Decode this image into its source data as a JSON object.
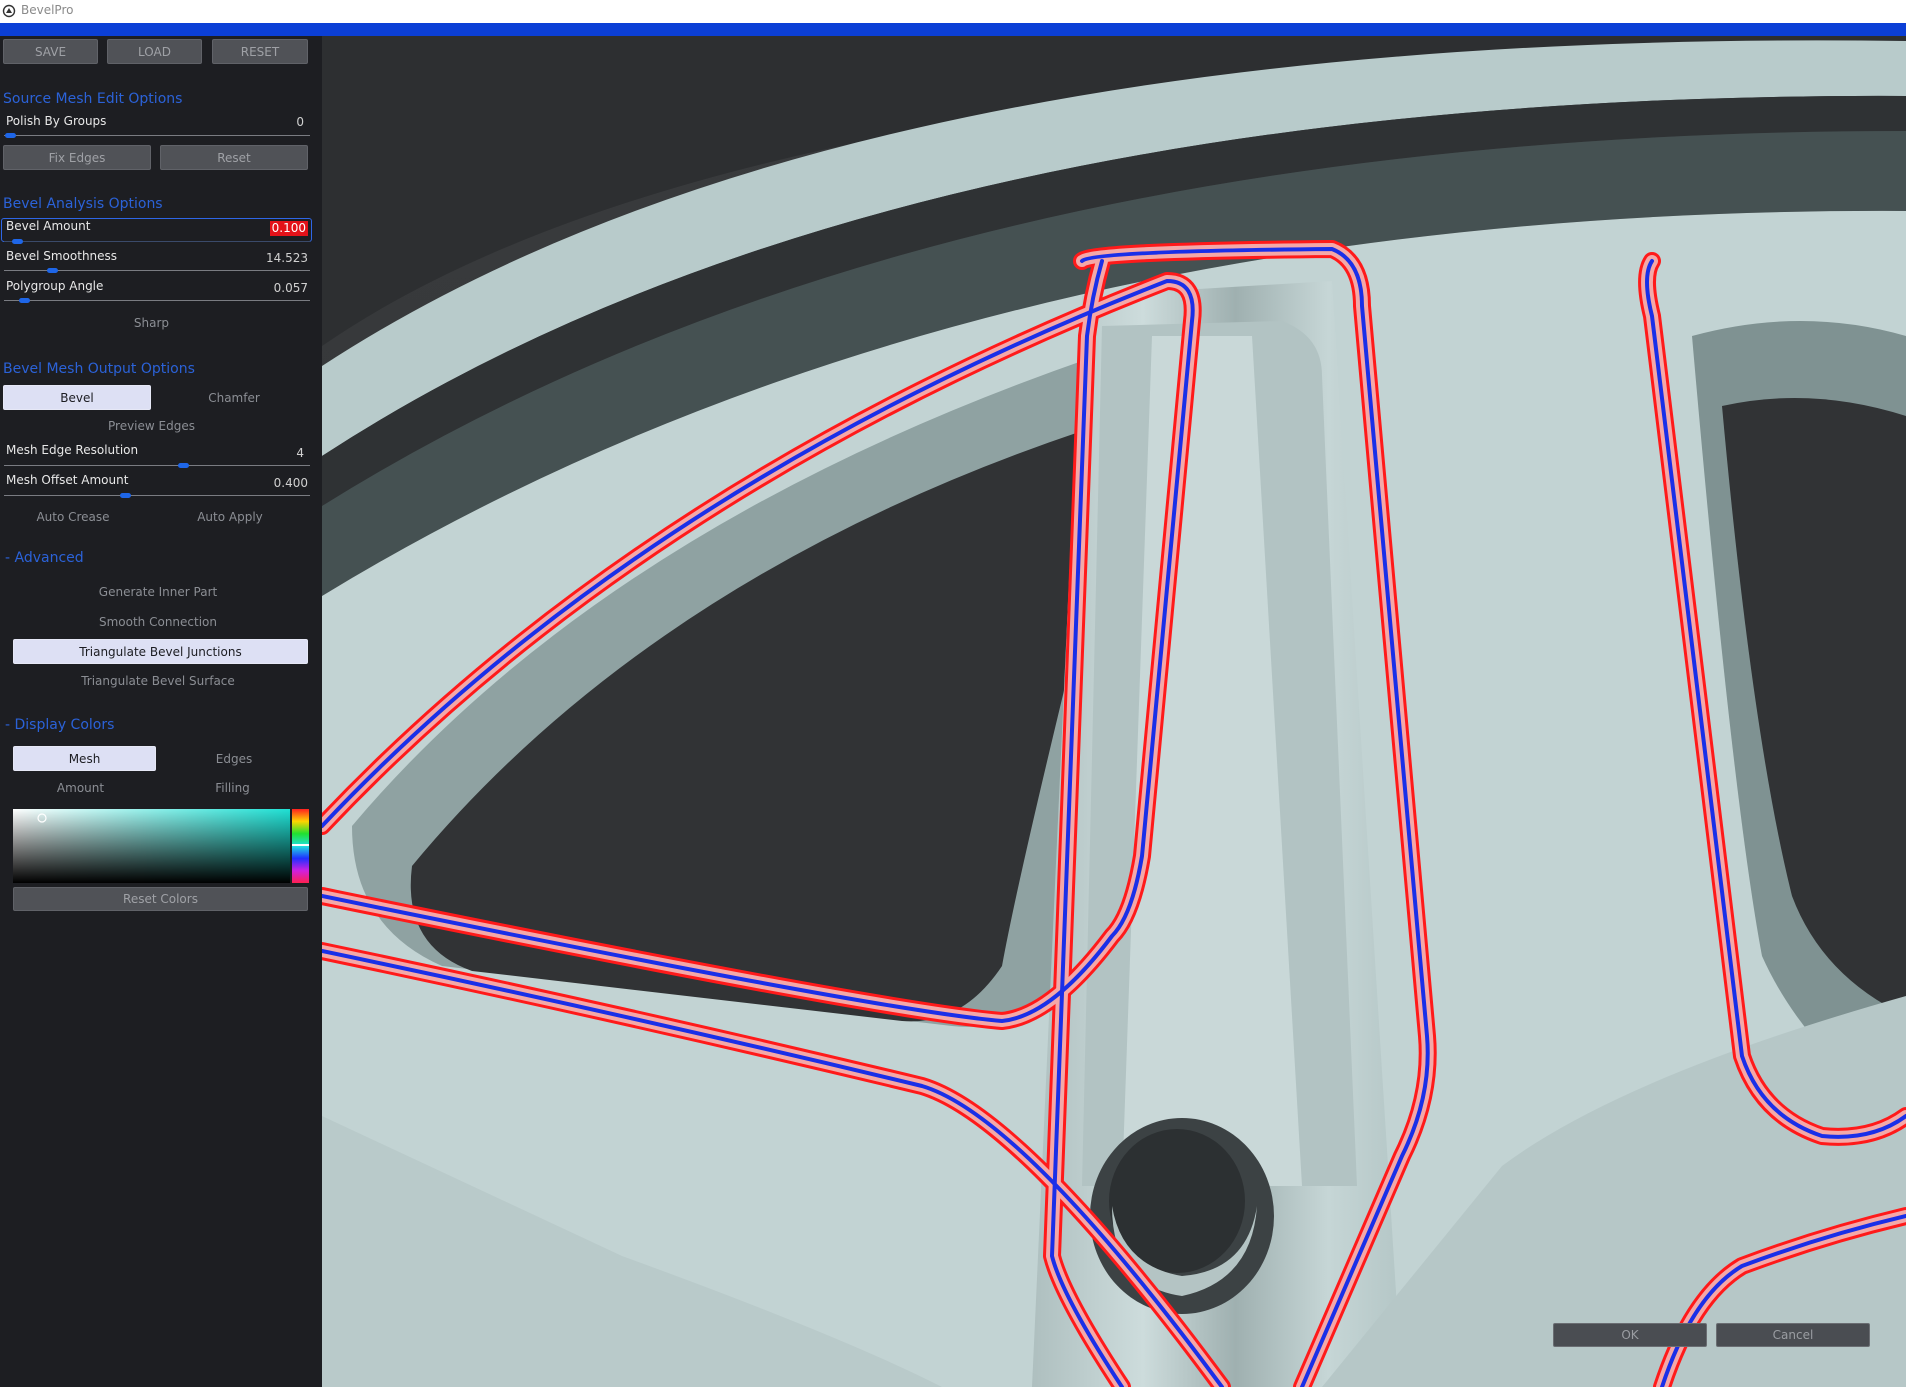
{
  "window": {
    "title": "BevelPro"
  },
  "toolbar": {
    "save": "SAVE",
    "load": "LOAD",
    "reset": "RESET"
  },
  "source_mesh": {
    "heading": "Source Mesh Edit Options",
    "polish_label": "Polish By Groups",
    "polish_value": "0",
    "fix_edges": "Fix Edges",
    "reset": "Reset"
  },
  "bevel_analysis": {
    "heading": "Bevel Analysis Options",
    "amount_label": "Bevel Amount",
    "amount_value": "0.100",
    "smoothness_label": "Bevel Smoothness",
    "smoothness_value": "14.523",
    "angle_label": "Polygroup Angle",
    "angle_value": "0.057",
    "sharp": "Sharp"
  },
  "bevel_output": {
    "heading": "Bevel Mesh Output Options",
    "bevel": "Bevel",
    "chamfer": "Chamfer",
    "preview_edges": "Preview Edges",
    "resolution_label": "Mesh Edge Resolution",
    "resolution_value": "4",
    "offset_label": "Mesh Offset Amount",
    "offset_value": "0.400",
    "auto_crease": "Auto Crease",
    "auto_apply": "Auto Apply"
  },
  "advanced": {
    "heading": "- Advanced",
    "generate_inner": "Generate Inner Part",
    "smooth_connection": "Smooth Connection",
    "triangulate_junctions": "Triangulate Bevel Junctions",
    "triangulate_surface": "Triangulate Bevel Surface"
  },
  "display_colors": {
    "heading": "- Display Colors",
    "mesh": "Mesh",
    "edges": "Edges",
    "amount": "Amount",
    "filling": "Filling",
    "reset_colors": "Reset Colors"
  },
  "dialog": {
    "ok": "OK",
    "cancel": "Cancel"
  },
  "colors": {
    "accent": "#0b3fd6",
    "heading": "#2b62d8",
    "edge_outer": "#ff1a1a",
    "edge_band": "#f4a8a8",
    "edge_inner": "#1a2fe8",
    "mesh": "#c6d6d6"
  }
}
